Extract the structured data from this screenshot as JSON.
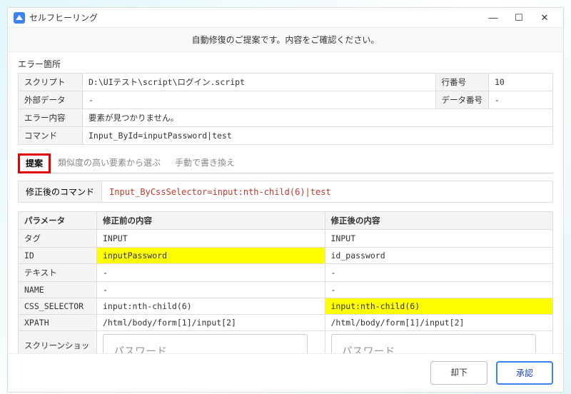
{
  "window": {
    "title": "セルフヒーリング"
  },
  "banner": "自動修復のご提案です。内容をご確認ください。",
  "error_section": {
    "label": "エラー箇所",
    "rows": {
      "script_label": "スクリプト",
      "script_value": "D:\\UIテスト\\script\\ログイン.script",
      "line_label": "行番号",
      "line_value": "10",
      "ext_label": "外部データ",
      "ext_value": "-",
      "data_label": "データ番号",
      "data_value": "-",
      "err_label": "エラー内容",
      "err_value": "要素が見つかりません。",
      "cmd_label": "コマンド",
      "cmd_value": "Input_ById=inputPassword|test"
    }
  },
  "tabs": {
    "t1": "提案",
    "t2": "類似度の高い要素から選ぶ",
    "t3": "手動で書き換え"
  },
  "fixed_cmd": {
    "label": "修正後のコマンド",
    "value": "Input_ByCssSelector=input:nth-child(6)|test"
  },
  "params": {
    "head_param": "パラメータ",
    "head_before": "修正前の内容",
    "head_after": "修正後の内容",
    "rows": [
      {
        "p": "タグ",
        "before": "INPUT",
        "after": "INPUT"
      },
      {
        "p": "ID",
        "before": "inputPassword",
        "after": "id_password"
      },
      {
        "p": "テキスト",
        "before": "-",
        "after": "-"
      },
      {
        "p": "NAME",
        "before": "-",
        "after": "-"
      },
      {
        "p": "CSS_SELECTOR",
        "before": "input:nth-child(6)",
        "after": "input:nth-child(6)"
      },
      {
        "p": "XPATH",
        "before": "/html/body/form[1]/input[2]",
        "after": "/html/body/form[1]/input[2]"
      }
    ],
    "screenshot_label": "スクリーンショット",
    "screenshot_placeholder": "パスワード"
  },
  "footer": {
    "reject": "却下",
    "accept": "承認"
  }
}
